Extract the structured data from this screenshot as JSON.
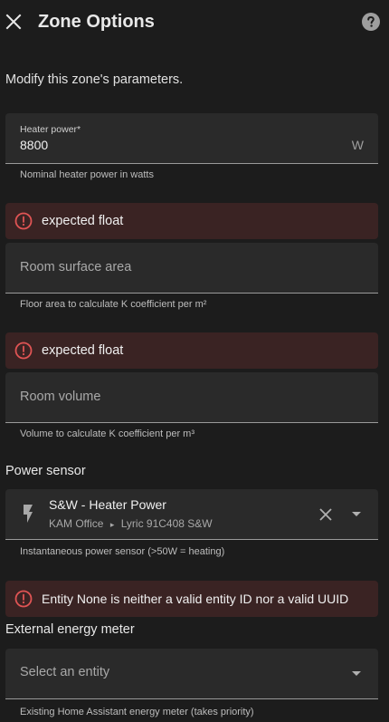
{
  "dialog": {
    "title": "Zone Options",
    "subtitle": "Modify this zone's parameters."
  },
  "heater_power": {
    "label": "Heater power*",
    "value": "8800",
    "suffix": "W",
    "helper": "Nominal heater power in watts"
  },
  "surface_area": {
    "error": "expected float",
    "placeholder": "Room surface area",
    "helper": "Floor area to calculate K coefficient per m²"
  },
  "room_volume": {
    "error": "expected float",
    "placeholder": "Room volume",
    "helper": "Volume to calculate K coefficient per m³"
  },
  "power_sensor": {
    "section_title": "Power sensor",
    "entity_name": "S&W - Heater Power",
    "area": "KAM Office",
    "separator": "▸",
    "device": "Lyric 91C408 S&W",
    "helper": "Instantaneous power sensor (>50W = heating)",
    "icon": "flash-icon"
  },
  "energy_meter": {
    "error": "Entity None is neither a valid entity ID nor a valid UUID",
    "section_title": "External energy meter",
    "placeholder": "Select an entity",
    "helper": "Existing Home Assistant energy meter (takes priority)"
  },
  "colors": {
    "background": "#1c1c1c",
    "field": "#2a2a2a",
    "error_bg": "#3a2323",
    "error_icon": "#e05454"
  }
}
